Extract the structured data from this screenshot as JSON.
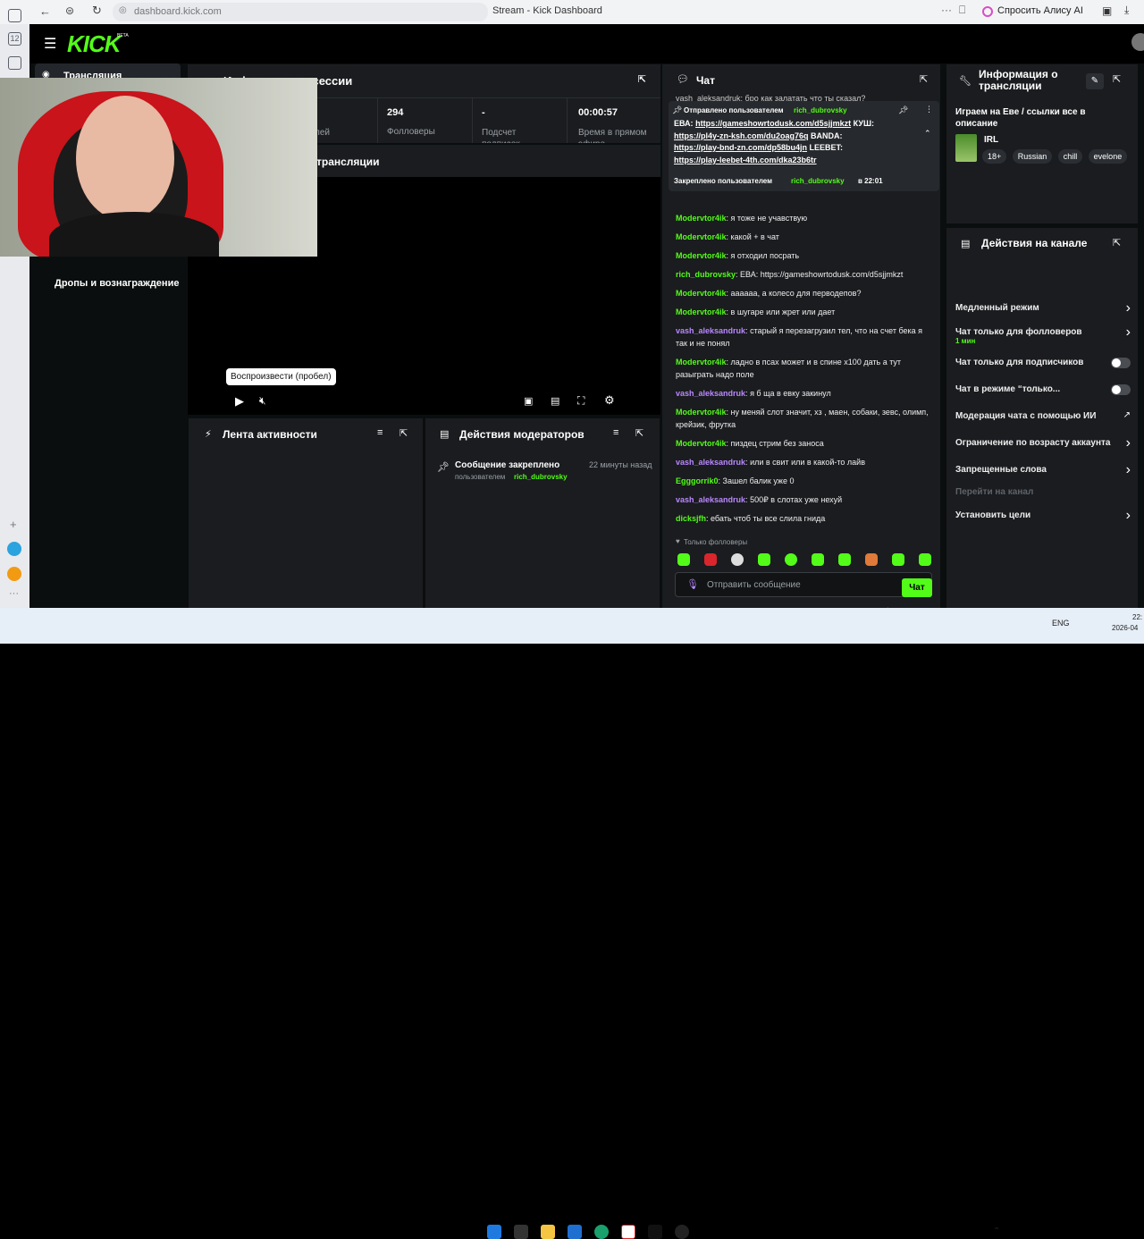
{
  "browser": {
    "url": "dashboard.kick.com",
    "title": "Stream - Kick Dashboard",
    "alice": "Спросить Алису AI",
    "more": "···"
  },
  "sidebar": {
    "stream_item": "Трансляция",
    "drops_item": "Дропы и вознаграждение"
  },
  "logo": {
    "text": "KICK",
    "sup": "BETA"
  },
  "session": {
    "title": "Информация о сессии",
    "stats": [
      {
        "value": "294",
        "label": "Фолловеры"
      },
      {
        "value": "-",
        "label": "Подсчет подписок"
      },
      {
        "value": "00:00:57",
        "label": "Время в прямом эфире"
      }
    ],
    "viewers_label": "лей"
  },
  "preview": {
    "title": "трансляции",
    "tooltip": "Воспроизвести (пробел)"
  },
  "activity": {
    "title": "Лента активности"
  },
  "mod_actions": {
    "title": "Действия модераторов",
    "item_title": "Сообщение закреплено",
    "item_time": "22 минуты назад",
    "item_by": "пользователем",
    "item_user": "rich_dubrovsky"
  },
  "chat": {
    "title": "Чат",
    "top_partial": "vash_aleksandruk: бро как залатать что ты сказал?",
    "pinned": {
      "sent_by": "Отправлено пользователем",
      "user": "rich_dubrovsky",
      "line1_prefix": "ЕВА:",
      "line1_link": "https://gameshowrtodusk.com/d5sjjmkzt",
      "line1_suffix": "КУШ:",
      "line2_link": "https://pl4y-zn-ksh.com/du2oag76q",
      "line2_suffix": "BANDA:",
      "line3_link": "https://play-bnd-zn.com/dp58bu4jn",
      "line3_suffix": "LEEBET:",
      "line4_link": "https://play-leebet-4th.com/dka23b6tr",
      "pinned_by": "Закреплено пользователем",
      "pinned_user": "rich_dubrovsky",
      "pinned_at": "в 22:01"
    },
    "messages": [
      {
        "user": "Modervtor4ik",
        "text": "я тоже не учавствую",
        "color": "#53fc18"
      },
      {
        "user": "Modervtor4ik",
        "text": "какой + в чат",
        "color": "#53fc18"
      },
      {
        "user": "Modervtor4ik",
        "text": "я отходил посрать",
        "color": "#53fc18"
      },
      {
        "user": "rich_dubrovsky",
        "text": "ЕВА: https://gameshowrtodusk.com/d5sjjmkzt",
        "color": "#53fc18"
      },
      {
        "user": "Modervtor4ik",
        "text": "аааааа, а колесо для перводепов?",
        "color": "#53fc18"
      },
      {
        "user": "Modervtor4ik",
        "text": "в шугаре или жрет или дает",
        "color": "#53fc18"
      },
      {
        "user": "vash_aleksandruk",
        "text": "старый я перезагрузил тел, что на счет бека я так и не понял",
        "color": "#b987ff"
      },
      {
        "user": "Modervtor4ik",
        "text": "ладно в псах может и в спине х100 дать а тут разыграть надо поле",
        "color": "#53fc18"
      },
      {
        "user": "vash_aleksandruk",
        "text": "я б ща в евку закинул",
        "color": "#b987ff"
      },
      {
        "user": "Modervtor4ik",
        "text": "ну меняй слот значит, хз , маен, собаки, зевс, олимп, крейзик, фрутка",
        "color": "#53fc18"
      },
      {
        "user": "Modervtor4ik",
        "text": "пиздец стрим без заноса",
        "color": "#53fc18"
      },
      {
        "user": "vash_aleksandruk",
        "text": "или в свит или в какой-то лайв",
        "color": "#b987ff"
      },
      {
        "user": "Egggorrik0",
        "text": "Зашел балик уже 0",
        "color": "#53fc18"
      },
      {
        "user": "vash_aleksandruk",
        "text": "500₽ в слотах уже нехуй",
        "color": "#b987ff"
      },
      {
        "user": "dicksjfh",
        "text": "ебать чтоб ты все слила гнида",
        "color": "#53fc18"
      }
    ],
    "followers_only": "Только фолловеры",
    "input_placeholder": "Отправить сообщение",
    "send": "Чат"
  },
  "stream_info": {
    "title": "Информация о трансляции",
    "stream_title": "Играем на Еве / ссылки все в описание",
    "category": "IRL",
    "tags": [
      "18+",
      "Russian",
      "chill",
      "evelone"
    ]
  },
  "channel_actions": {
    "title": "Действия на канале",
    "items": [
      {
        "label": "Медленный режим",
        "sub": "",
        "control": "chevron"
      },
      {
        "label": "Чат только для фолловеров",
        "sub": "1 мин",
        "control": "chevron"
      },
      {
        "label": "Чат только для подписчиков",
        "sub": "",
        "control": "toggle"
      },
      {
        "label": "Чат в режиме “только...",
        "sub": "",
        "control": "toggle"
      },
      {
        "label": "Модерация чата с помощью ИИ",
        "sub": "",
        "control": "external"
      },
      {
        "label": "Ограничение по возрасту аккаунта",
        "sub": "",
        "control": "chevron"
      },
      {
        "label": "Запрещенные слова",
        "sub": "",
        "control": "chevron"
      },
      {
        "label": "Перейти на канал",
        "sub": "",
        "control": "none"
      },
      {
        "label": "Установить цели",
        "sub": "",
        "control": "chevron"
      }
    ]
  },
  "taskbar": {
    "lang": "ENG",
    "time": "22:",
    "date": "2026-04"
  },
  "colors": {
    "accent": "#53fc18",
    "purple": "#b987ff",
    "panel": "#1a1c1f"
  }
}
